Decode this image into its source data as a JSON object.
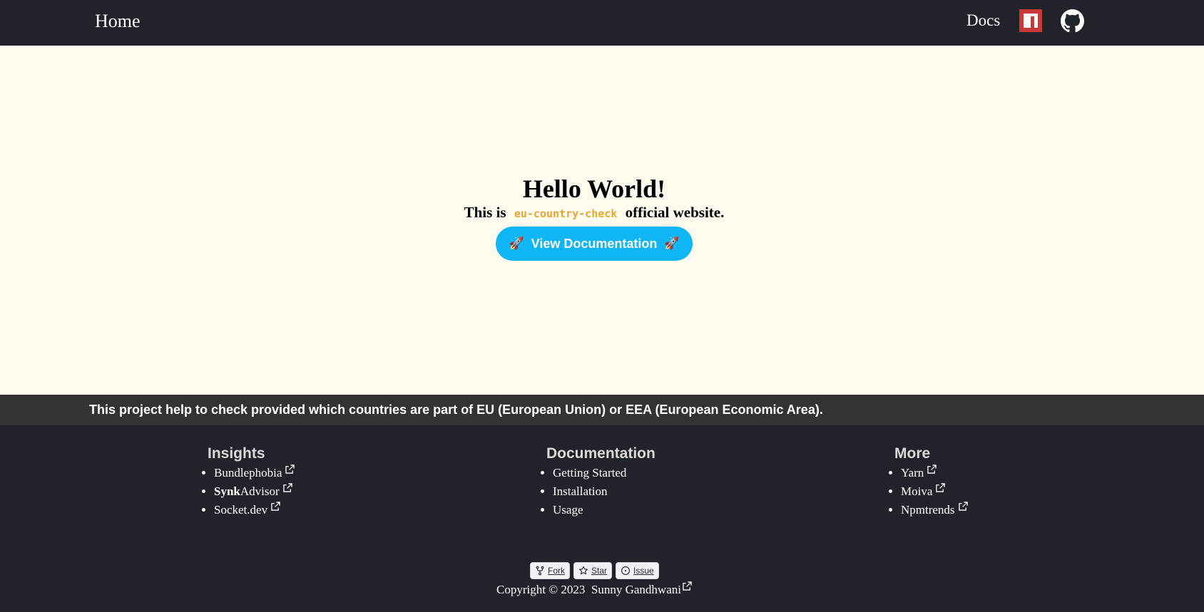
{
  "navbar": {
    "home_label": "Home",
    "docs_label": "Docs",
    "npm_icon": "npm-icon",
    "github_icon": "github-icon"
  },
  "hero": {
    "title": "Hello World!",
    "subtitle_prefix": "This is",
    "package_name": "eu-country-check",
    "subtitle_suffix": "official website.",
    "cta_label": "View Documentation",
    "cta_icon": "rocket-icon"
  },
  "tagline": "This project help to check provided which countries are part of EU (European Union) or EEA (European Economic Area).",
  "footer": {
    "columns": [
      {
        "heading": "Insights",
        "items": [
          {
            "label": "Bundlephobia",
            "external": true
          },
          {
            "label_bold": "Synk",
            "label": "Advisor",
            "external": true
          },
          {
            "label": "Socket.dev",
            "external": true
          }
        ]
      },
      {
        "heading": "Documentation",
        "items": [
          {
            "label": "Getting Started",
            "external": false
          },
          {
            "label": "Installation",
            "external": false
          },
          {
            "label": "Usage",
            "external": false
          }
        ]
      },
      {
        "heading": "More",
        "items": [
          {
            "label": "Yarn",
            "external": true
          },
          {
            "label": "Moiva",
            "external": true
          },
          {
            "label": "Npmtrends",
            "external": true
          }
        ]
      }
    ],
    "github_buttons": [
      {
        "label": "Fork",
        "icon": "fork-icon"
      },
      {
        "label": "Star",
        "icon": "star-icon"
      },
      {
        "label": "Issue",
        "icon": "issue-icon"
      }
    ],
    "copyright_prefix": "Copyright © 2023",
    "copyright_author": "Sunny Gandhwani"
  },
  "colors": {
    "navbar_bg": "#20232a",
    "hero_bg": "#fffaee",
    "accent": "#0fb5f4",
    "package_name": "#e5a730",
    "tagline_bg": "#333333",
    "npm_red": "#cb3837"
  }
}
